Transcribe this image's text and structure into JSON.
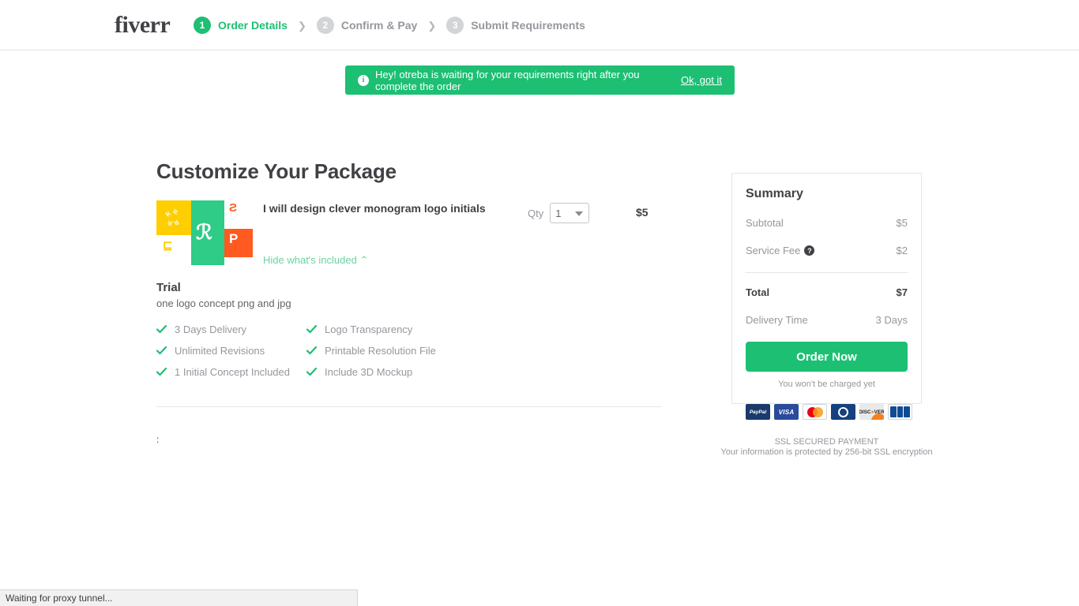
{
  "header": {
    "logo": "fiverr",
    "steps": [
      {
        "number": "1",
        "label": "Order Details",
        "state": "active"
      },
      {
        "number": "2",
        "label": "Confirm & Pay",
        "state": "inactive"
      },
      {
        "number": "3",
        "label": "Submit Requirements",
        "state": "inactive"
      }
    ],
    "separator": "❯"
  },
  "banner": {
    "icon": "info-icon",
    "text": "Hey! otreba is waiting for your requirements right after you complete the order",
    "action_label": "Ok, got it",
    "background_color": "#1dbf73"
  },
  "main": {
    "page_title": "Customize Your Package",
    "gig": {
      "title": "I will design clever monogram logo initials",
      "toggle_label": "Hide what's included ⌃",
      "qty_label": "Qty",
      "qty_value": "1",
      "price": "$5"
    },
    "package": {
      "name": "Trial",
      "description": "one logo concept png and jpg",
      "features": [
        "3 Days Delivery",
        "Logo Transparency",
        "Unlimited Revisions",
        "Printable Resolution File",
        "1 Initial Concept Included",
        "Include 3D Mockup"
      ]
    },
    "stray_text": ":"
  },
  "summary": {
    "title": "Summary",
    "rows": [
      {
        "label": "Subtotal",
        "value": "$5",
        "help": false
      },
      {
        "label": "Service Fee",
        "value": "$2",
        "help": true
      }
    ],
    "total": {
      "label": "Total",
      "value": "$7"
    },
    "delivery": {
      "label": "Delivery Time",
      "value": "3 Days"
    },
    "order_button": "Order Now",
    "no_charge_note": "You won't be charged yet",
    "help_icon_glyph": "?",
    "accent_color": "#1dbf73"
  },
  "payment": {
    "methods": [
      "PayPal",
      "VISA",
      "MasterCard",
      "Diners Club",
      "DISCOVER",
      "JCB"
    ],
    "ssl_headline": "SSL SECURED PAYMENT",
    "ssl_subtext": "Your information is protected by 256-bit SSL encryption"
  },
  "statusbar": {
    "text": "Waiting for proxy tunnel..."
  }
}
